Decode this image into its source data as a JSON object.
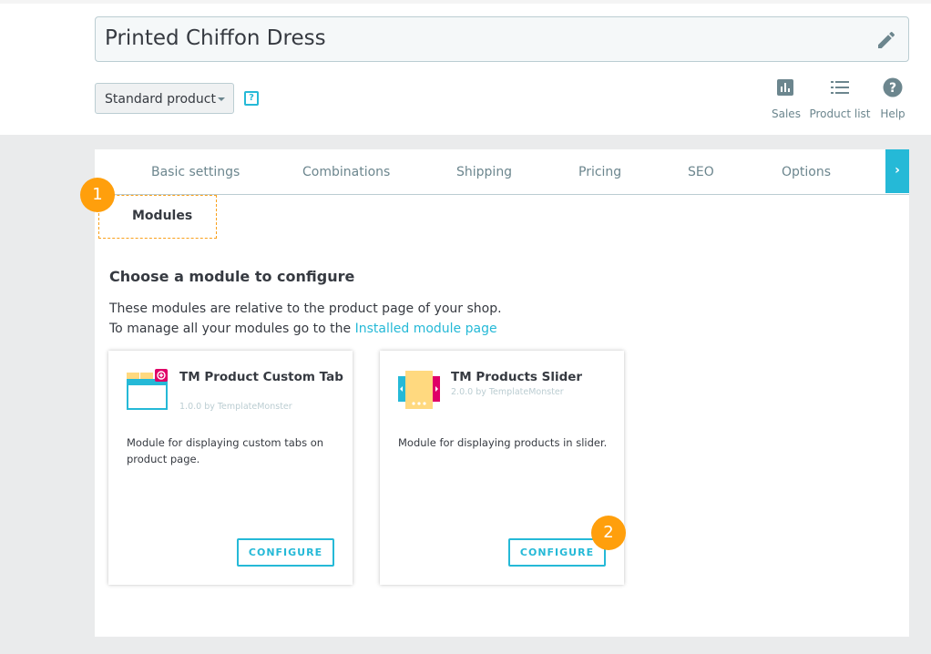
{
  "header": {
    "product_name": "Printed Chiffon Dress",
    "product_type": "Standard product",
    "help_glyph": "?",
    "toolbar": [
      {
        "label": "Sales",
        "icon": "bar-chart-icon"
      },
      {
        "label": "Product list",
        "icon": "list-icon"
      },
      {
        "label": "Help",
        "icon": "help-circle-icon"
      }
    ]
  },
  "tabs": [
    {
      "label": "Basic settings"
    },
    {
      "label": "Combinations"
    },
    {
      "label": "Shipping"
    },
    {
      "label": "Pricing"
    },
    {
      "label": "SEO"
    },
    {
      "label": "Options"
    },
    {
      "label": "Modules",
      "active": true
    }
  ],
  "tab_next_glyph": "›",
  "badges": {
    "first": "1",
    "second": "2"
  },
  "content": {
    "heading": "Choose a module to configure",
    "line1": "These modules are relative to the product page of your shop.",
    "line2_prefix": "To manage all your modules go to the ",
    "line2_link": "Installed module page"
  },
  "modules": [
    {
      "name": "TM Product Custom Tab",
      "version": "1.0.0 by TemplateMonster",
      "description": "Module for displaying custom tabs on product page.",
      "button": "CONFIGURE",
      "icon": "custom-tab-icon"
    },
    {
      "name": "TM Products Slider",
      "version": "2.0.0 by TemplateMonster",
      "description": "Module for displaying products in slider.",
      "button": "CONFIGURE",
      "icon": "slider-icon"
    }
  ],
  "colors": {
    "accent": "#25b9d7",
    "badge": "#ff9f0c",
    "background": "#eaebec"
  }
}
